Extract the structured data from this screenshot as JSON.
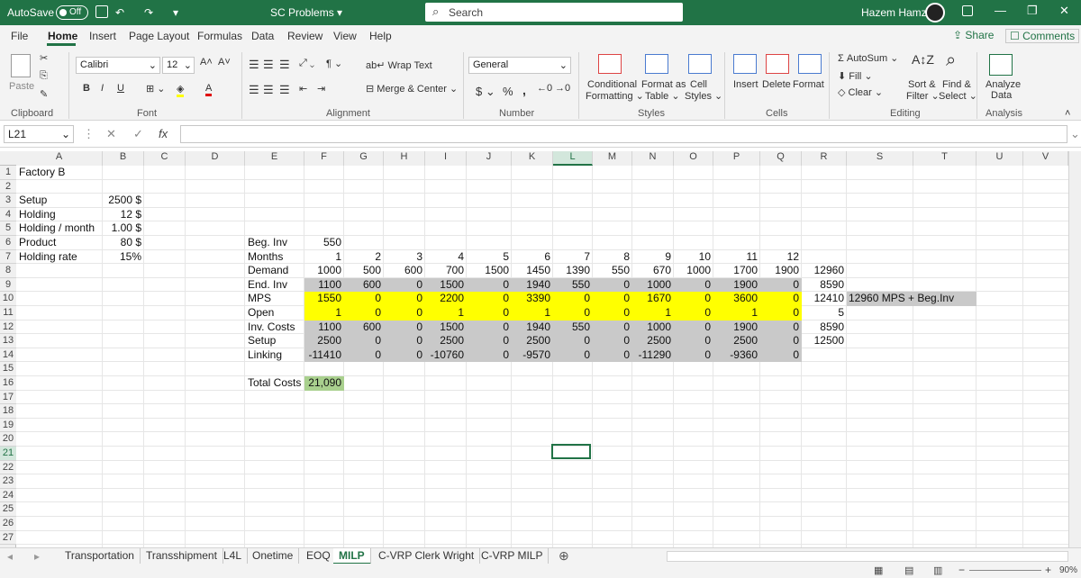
{
  "titlebar": {
    "autosave": "AutoSave",
    "autosave_state": "Off",
    "doc_title": "SC Problems",
    "search_placeholder": "Search",
    "user": "Hazem Hamza"
  },
  "menu": [
    "File",
    "Home",
    "Insert",
    "Page Layout",
    "Formulas",
    "Data",
    "Review",
    "View",
    "Help"
  ],
  "share": "Share",
  "comments": "Comments",
  "ribbon": {
    "clipboard": {
      "paste": "Paste",
      "group": "Clipboard"
    },
    "font": {
      "name": "Calibri",
      "size": "12",
      "bold": "B",
      "italic": "I",
      "underline": "U",
      "group": "Font"
    },
    "alignment": {
      "wrap": "Wrap Text",
      "merge": "Merge & Center",
      "group": "Alignment"
    },
    "number": {
      "format": "General",
      "currency": "$",
      "percent": "%",
      "comma": ",",
      "group": "Number"
    },
    "styles": {
      "cond1": "Conditional",
      "cond2": "Formatting",
      "table1": "Format as",
      "table2": "Table",
      "cell1": "Cell",
      "cell2": "Styles",
      "group": "Styles"
    },
    "cells": {
      "insert": "Insert",
      "delete": "Delete",
      "format": "Format",
      "group": "Cells"
    },
    "editing": {
      "autosum": "AutoSum",
      "fill": "Fill",
      "clear": "Clear",
      "sort1": "Sort &",
      "sort2": "Filter",
      "find1": "Find &",
      "find2": "Select",
      "group": "Editing"
    },
    "analysis": {
      "a1": "Analyze",
      "a2": "Data",
      "group": "Analysis"
    }
  },
  "namebox": "L21",
  "fx": "fx",
  "columns": [
    "A",
    "B",
    "C",
    "D",
    "E",
    "F",
    "G",
    "H",
    "I",
    "J",
    "K",
    "L",
    "M",
    "N",
    "O",
    "P",
    "Q",
    "R",
    "S",
    "T",
    "U",
    "V"
  ],
  "rows": [
    "1",
    "2",
    "3",
    "4",
    "5",
    "6",
    "7",
    "8",
    "9",
    "10",
    "11",
    "12",
    "13",
    "14",
    "15",
    "16",
    "17",
    "18",
    "19",
    "20",
    "21",
    "22",
    "23",
    "24",
    "25",
    "26",
    "27"
  ],
  "cells": {
    "A1": "Factory B",
    "A3": "Setup",
    "B3": "2500 $",
    "A4": "Holding",
    "B4": "12 $",
    "A5": "Holding / month",
    "B5": "1.00 $",
    "A6": "Product",
    "B6": "80 $",
    "A7": "Holding rate",
    "B7": "15%",
    "E6": "Beg. Inv",
    "F6": "550",
    "E7": "Months",
    "E8": "Demand",
    "E9": "End. Inv",
    "E10": "MPS",
    "E11": "Open",
    "E12": "Inv. Costs",
    "E13": "Setup",
    "E14": "Linking",
    "E16": "Total Costs",
    "F16": "21,090",
    "R8": "12960",
    "R9": "8590",
    "R10": "12410",
    "R11": "5",
    "R12": "8590",
    "R13": "12500",
    "T10": "12960 MPS + Beg.Inv"
  },
  "table": {
    "months": [
      "1",
      "2",
      "3",
      "4",
      "5",
      "6",
      "7",
      "8",
      "9",
      "10",
      "11",
      "12"
    ],
    "demand": [
      "1000",
      "500",
      "600",
      "700",
      "1500",
      "1450",
      "1390",
      "550",
      "670",
      "1000",
      "1700",
      "1900"
    ],
    "end_inv": [
      "1100",
      "600",
      "0",
      "1500",
      "0",
      "1940",
      "550",
      "0",
      "1000",
      "0",
      "1900",
      "0"
    ],
    "mps": [
      "1550",
      "0",
      "0",
      "2200",
      "0",
      "3390",
      "0",
      "0",
      "1670",
      "0",
      "3600",
      "0"
    ],
    "open": [
      "1",
      "0",
      "0",
      "1",
      "0",
      "1",
      "0",
      "0",
      "1",
      "0",
      "1",
      "0"
    ],
    "inv_costs": [
      "1100",
      "600",
      "0",
      "1500",
      "0",
      "1940",
      "550",
      "0",
      "1000",
      "0",
      "1900",
      "0"
    ],
    "setup": [
      "2500",
      "0",
      "0",
      "2500",
      "0",
      "2500",
      "0",
      "0",
      "2500",
      "0",
      "2500",
      "0"
    ],
    "linking": [
      "-11410",
      "0",
      "0",
      "-10760",
      "0",
      "-9570",
      "0",
      "0",
      "-11290",
      "0",
      "-9360",
      "0"
    ]
  },
  "sheets": [
    "Transportation",
    "Transshipment",
    "L4L",
    "Onetime",
    "EOQ",
    "MILP",
    "C-VRP Clerk Wright",
    "C-VRP MILP"
  ],
  "active_sheet": "MILP",
  "zoom": "90%",
  "colors": {
    "excel_green": "#217346",
    "highlight_gray": "#c9c9c9",
    "highlight_yellow": "#ffff00",
    "total_green": "#a9d08e"
  }
}
